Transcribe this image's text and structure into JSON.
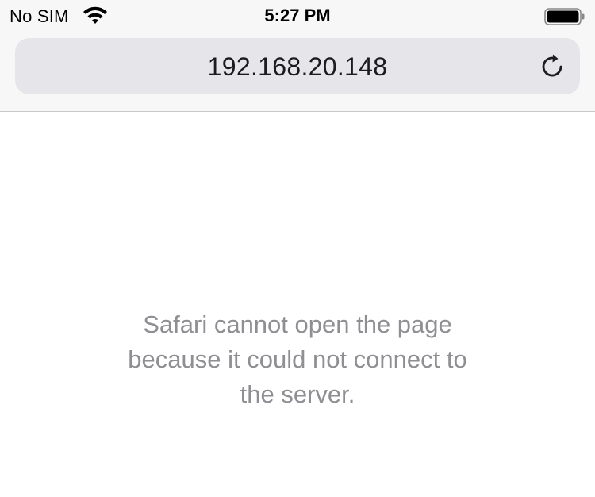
{
  "status_bar": {
    "carrier": "No SIM",
    "time": "5:27 PM",
    "wifi_icon": "wifi-icon",
    "battery_icon": "battery-full-icon"
  },
  "address_bar": {
    "url": "192.168.20.148",
    "reload_icon": "reload-icon"
  },
  "content": {
    "error_line1": "Safari cannot open the page",
    "error_line2": "because it could not connect to",
    "error_line3": "the server."
  },
  "colors": {
    "chrome_background": "#f7f7f7",
    "url_field": "#e5e5ea",
    "error_text": "#8e8e93"
  }
}
